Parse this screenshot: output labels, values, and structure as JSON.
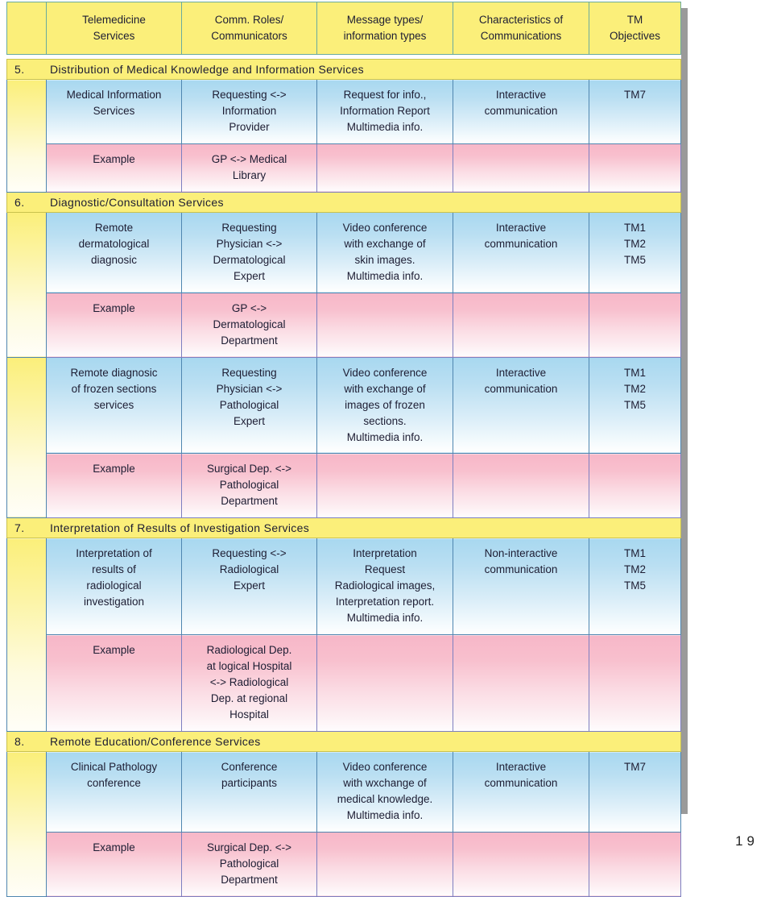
{
  "page": {
    "number": "19"
  },
  "table": {
    "headers": [
      {
        "lines": [
          "Telemedicine",
          "Services"
        ]
      },
      {
        "lines": [
          "Comm. Roles/",
          "Communicators"
        ]
      },
      {
        "lines": [
          "Message types/",
          "information types"
        ]
      },
      {
        "lines": [
          "Characteristics of",
          "Communications"
        ]
      },
      {
        "lines": [
          "TM",
          "Objectives"
        ]
      }
    ],
    "sections": [
      {
        "number": "5.",
        "title": "Distribution of Medical Knowledge and Information Services",
        "groups": [
          {
            "service": {
              "cells": [
                [
                  "Medical Information",
                  "Services"
                ],
                [
                  "Requesting <->",
                  "Information",
                  "Provider"
                ],
                [
                  "Request for info.,",
                  "Information Report",
                  "Multimedia info."
                ],
                [
                  "Interactive",
                  "communication"
                ],
                [
                  "TM7"
                ]
              ]
            },
            "example": {
              "cells": [
                [
                  "Example"
                ],
                [
                  "GP <-> Medical",
                  "Library"
                ],
                [],
                [],
                []
              ]
            }
          }
        ]
      },
      {
        "number": "6.",
        "title": "Diagnostic/Consultation Services",
        "groups": [
          {
            "service": {
              "cells": [
                [
                  "Remote",
                  "dermatological",
                  "diagnosic"
                ],
                [
                  "Requesting",
                  "Physician <->",
                  "Dermatological",
                  "Expert"
                ],
                [
                  "Video conference",
                  "with exchange of",
                  "skin images.",
                  "Multimedia info."
                ],
                [
                  "Interactive",
                  "communication"
                ],
                [
                  "TM1",
                  "TM2",
                  "TM5"
                ]
              ]
            },
            "example": {
              "cells": [
                [
                  "Example"
                ],
                [
                  "GP <->",
                  "Dermatological",
                  "Department"
                ],
                [],
                [],
                []
              ]
            }
          },
          {
            "service": {
              "cells": [
                [
                  "Remote diagnosic",
                  "of frozen sections",
                  "services"
                ],
                [
                  "Requesting",
                  "Physician <->",
                  "Pathological",
                  "Expert"
                ],
                [
                  "Video conference",
                  "with exchange of",
                  "images of frozen",
                  "sections.",
                  "Multimedia info."
                ],
                [
                  "Interactive",
                  "communication"
                ],
                [
                  "TM1",
                  "TM2",
                  "TM5"
                ]
              ]
            },
            "example": {
              "cells": [
                [
                  "Example"
                ],
                [
                  "Surgical Dep. <->",
                  "Pathological",
                  "Department"
                ],
                [],
                [],
                []
              ]
            }
          }
        ]
      },
      {
        "number": "7.",
        "title": "Interpretation of Results of Investigation Services",
        "groups": [
          {
            "service": {
              "cells": [
                [
                  "Interpretation of",
                  "results of",
                  "radiological",
                  "investigation"
                ],
                [
                  "Requesting <->",
                  "Radiological",
                  "Expert"
                ],
                [
                  "Interpretation",
                  "Request",
                  "Radiological images,",
                  "Interpretation report.",
                  "Multimedia info."
                ],
                [
                  "Non-interactive",
                  "communication"
                ],
                [
                  "TM1",
                  "TM2",
                  "TM5"
                ]
              ]
            },
            "example": {
              "cells": [
                [
                  "Example"
                ],
                [
                  "Radiological Dep.",
                  "at logical Hospital",
                  "<-> Radiological",
                  "Dep. at regional",
                  "Hospital"
                ],
                [],
                [],
                []
              ]
            }
          }
        ]
      },
      {
        "number": "8.",
        "title": "Remote Education/Conference Services",
        "groups": [
          {
            "service": {
              "cells": [
                [
                  "Clinical Pathology",
                  "conference"
                ],
                [
                  "Conference",
                  "participants"
                ],
                [
                  "Video conference",
                  "with wxchange of",
                  "medical knowledge.",
                  "Multimedia info."
                ],
                [
                  "Interactive",
                  "communication"
                ],
                [
                  "TM7"
                ]
              ]
            },
            "example": {
              "cells": [
                [
                  "Example"
                ],
                [
                  "Surgical Dep. <->",
                  "Pathological",
                  "Department"
                ],
                [],
                [],
                []
              ]
            }
          }
        ]
      }
    ]
  }
}
